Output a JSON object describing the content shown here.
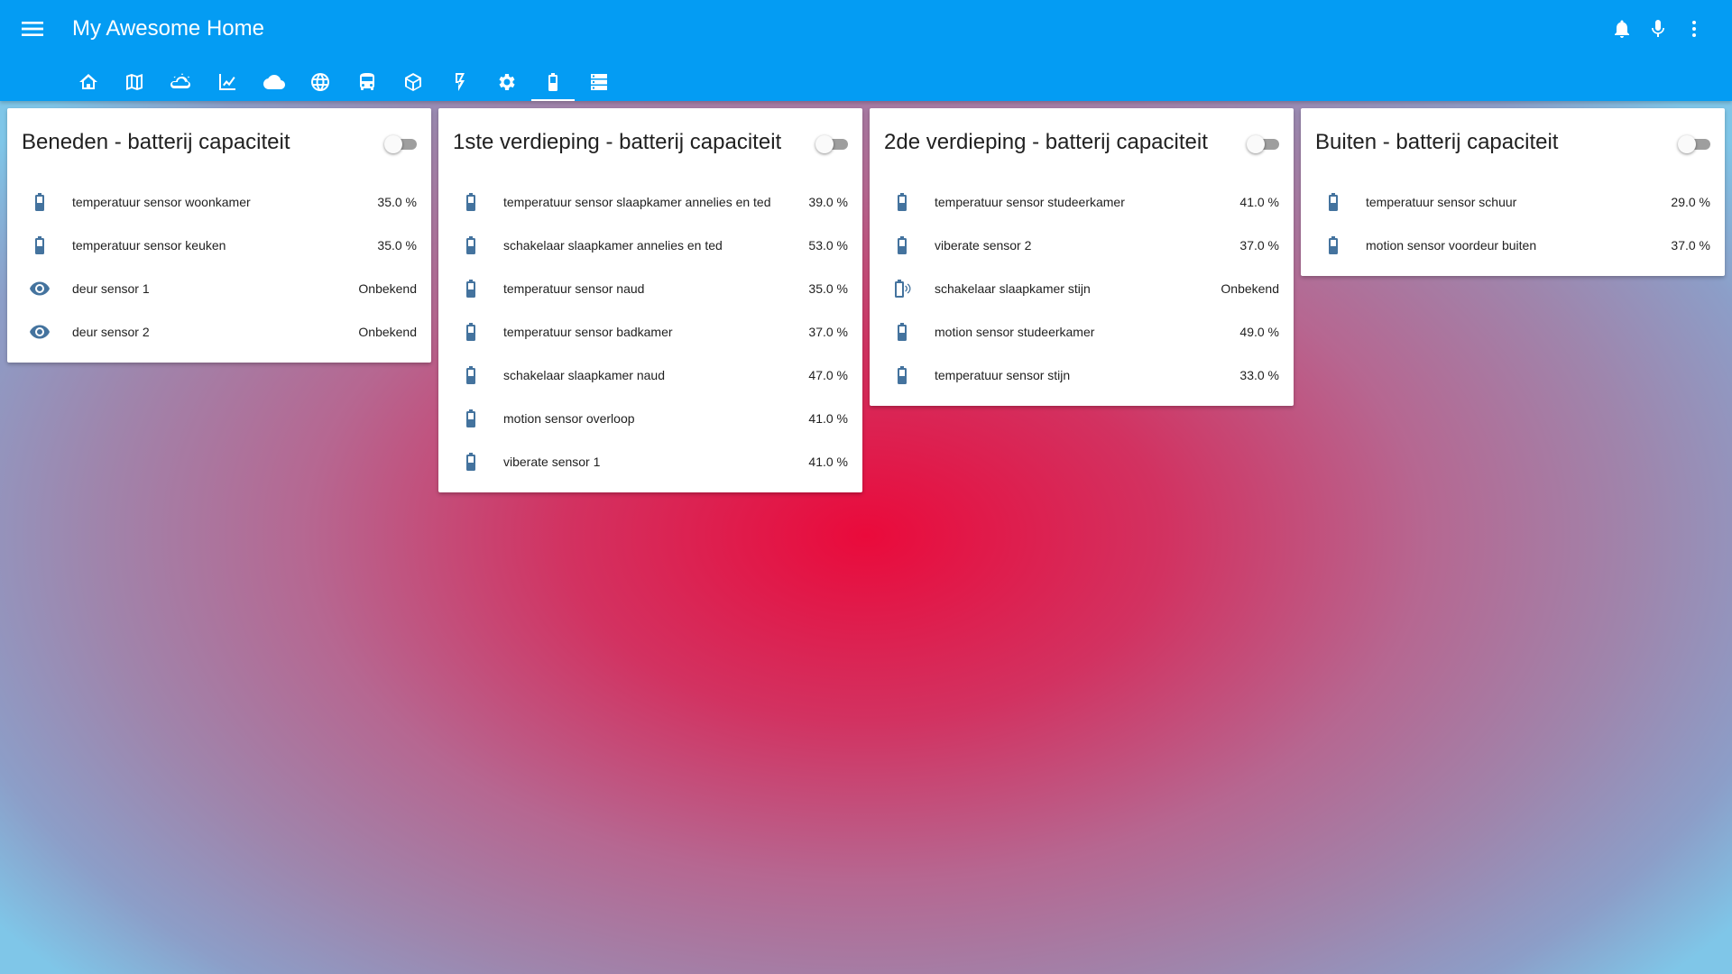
{
  "app": {
    "title": "My Awesome Home",
    "colors": {
      "header": "#049cf3",
      "icon_state": "#44739e"
    }
  },
  "header": {
    "menu_icon": "menu-icon",
    "actions": [
      {
        "name": "notifications-button",
        "icon": "bell-icon"
      },
      {
        "name": "voice-button",
        "icon": "microphone-icon"
      },
      {
        "name": "overflow-menu-button",
        "icon": "dots-vertical-icon"
      }
    ]
  },
  "tabs": [
    {
      "name": "tab-home",
      "icon": "home-icon",
      "active": false
    },
    {
      "name": "tab-map",
      "icon": "map-icon",
      "active": false
    },
    {
      "name": "tab-weather",
      "icon": "weather-icon",
      "active": false
    },
    {
      "name": "tab-history",
      "icon": "chart-line-icon",
      "active": false
    },
    {
      "name": "tab-cloud",
      "icon": "cloud-icon",
      "active": false
    },
    {
      "name": "tab-network",
      "icon": "globe-icon",
      "active": false
    },
    {
      "name": "tab-transport",
      "icon": "bus-icon",
      "active": false
    },
    {
      "name": "tab-packages",
      "icon": "cube-icon",
      "active": false
    },
    {
      "name": "tab-energy",
      "icon": "flash-icon",
      "active": false
    },
    {
      "name": "tab-settings",
      "icon": "gear-icon",
      "active": false
    },
    {
      "name": "tab-battery",
      "icon": "battery-icon",
      "active": true
    },
    {
      "name": "tab-server",
      "icon": "server-icon",
      "active": false
    }
  ],
  "cards": [
    {
      "title": "Beneden - batterij capaciteit",
      "toggle_on": false,
      "rows": [
        {
          "icon": "battery-icon",
          "name": "temperatuur sensor woonkamer",
          "state": "35.0 %"
        },
        {
          "icon": "battery-icon",
          "name": "temperatuur sensor keuken",
          "state": "35.0 %"
        },
        {
          "icon": "eye-icon",
          "name": "deur sensor 1",
          "state": "Onbekend"
        },
        {
          "icon": "eye-icon",
          "name": "deur sensor 2",
          "state": "Onbekend"
        }
      ]
    },
    {
      "title": "1ste verdieping - batterij capaciteit",
      "toggle_on": false,
      "rows": [
        {
          "icon": "battery-icon",
          "name": "temperatuur sensor slaapkamer annelies en ted",
          "state": "39.0 %"
        },
        {
          "icon": "battery-icon",
          "name": "schakelaar slaapkamer annelies en ted",
          "state": "53.0 %"
        },
        {
          "icon": "battery-icon",
          "name": "temperatuur sensor naud",
          "state": "35.0 %"
        },
        {
          "icon": "battery-icon",
          "name": "temperatuur sensor badkamer",
          "state": "37.0 %"
        },
        {
          "icon": "battery-icon",
          "name": "schakelaar slaapkamer naud",
          "state": "47.0 %"
        },
        {
          "icon": "battery-icon",
          "name": "motion sensor overloop",
          "state": "41.0 %"
        },
        {
          "icon": "battery-icon",
          "name": "viberate sensor 1",
          "state": "41.0 %"
        }
      ]
    },
    {
      "title": "2de verdieping - batterij capaciteit",
      "toggle_on": false,
      "rows": [
        {
          "icon": "battery-icon",
          "name": "temperatuur sensor studeerkamer",
          "state": "41.0 %"
        },
        {
          "icon": "battery-icon",
          "name": "viberate sensor 2",
          "state": "37.0 %"
        },
        {
          "icon": "battery-unknown-icon",
          "name": "schakelaar slaapkamer stijn",
          "state": "Onbekend"
        },
        {
          "icon": "battery-icon",
          "name": "motion sensor studeerkamer",
          "state": "49.0 %"
        },
        {
          "icon": "battery-icon",
          "name": "temperatuur sensor stijn",
          "state": "33.0 %"
        }
      ]
    },
    {
      "title": "Buiten - batterij capaciteit",
      "toggle_on": false,
      "rows": [
        {
          "icon": "battery-icon",
          "name": "temperatuur sensor schuur",
          "state": "29.0 %"
        },
        {
          "icon": "battery-icon",
          "name": "motion sensor voordeur buiten",
          "state": "37.0 %"
        }
      ]
    }
  ]
}
